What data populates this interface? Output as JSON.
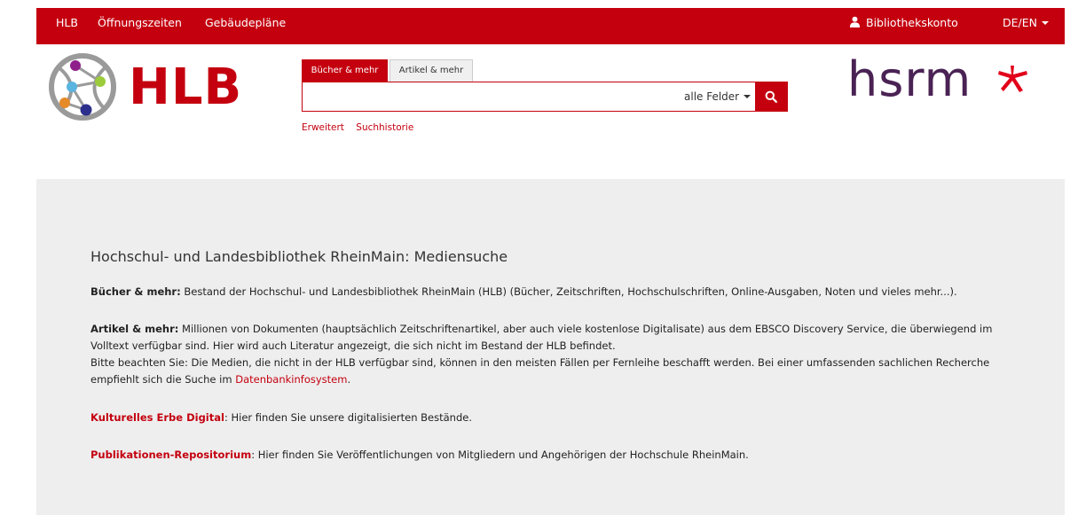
{
  "nav": {
    "hlb": "HLB",
    "oeffnungszeiten": "Öffnungszeiten",
    "gebaeudeplaene": "Gebäudepläne",
    "account": "Bibliothekskonto",
    "language": "DE/EN"
  },
  "logos": {
    "hlb": "HLB",
    "hsrm": "hsrm"
  },
  "search": {
    "tabs": [
      "Bücher & mehr",
      "Artikel & mehr"
    ],
    "value": "",
    "placeholder": "",
    "field_select": "alle Felder",
    "links": [
      "Erweitert",
      "Suchhistorie"
    ]
  },
  "content": {
    "title": "Hochschul- und Landesbibliothek RheinMain: Mediensuche",
    "books_label": "Bücher & mehr:",
    "books_text": " Bestand der Hochschul- und Landesbibliothek RheinMain (HLB) (Bücher, Zeitschriften, Hochschulschriften, Online-Ausgaben, Noten und vieles mehr...).",
    "articles_label": "Artikel & mehr:",
    "articles_text": " Millionen von Dokumenten (hauptsächlich Zeitschriftenartikel, aber auch viele kostenlose Digitalisate) aus dem EBSCO Discovery Service, die überwiegend im Volltext verfügbar sind. Hier wird auch Literatur angezeigt, die sich nicht im Bestand der HLB befindet.",
    "articles_note": "Bitte beachten Sie: Die Medien, die nicht in der HLB verfügbar sind, können in den meisten Fällen per Fernleihe beschafft werden. Bei einer umfassenden sachlichen Recherche empfiehlt sich die Suche im ",
    "dbis_link": "Datenbankinfosystem",
    "dbis_after": ".",
    "kulturelles_link": "Kulturelles Erbe Digital",
    "kulturelles_text": ": Hier finden Sie unsere digitalisierten Bestände.",
    "publikationen_link": "Publikationen-Repositorium",
    "publikationen_text": ": Hier finden Sie Veröffentlichungen von Mitgliedern und Angehörigen der Hochschule RheinMain."
  },
  "colors": {
    "brand_red": "#c4000f",
    "hsrm_purple": "#4a2254",
    "panel_bg": "#eeeeee"
  }
}
